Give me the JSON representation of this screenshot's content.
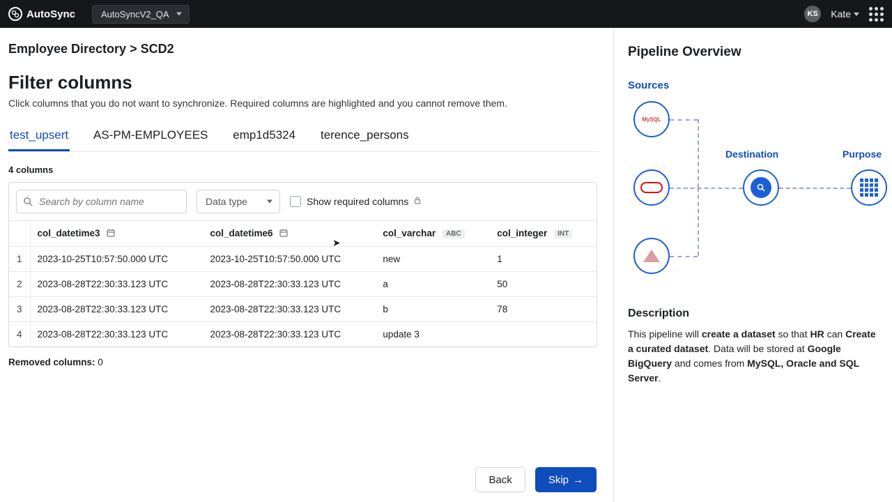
{
  "topbar": {
    "brand": "AutoSync",
    "environment": "AutoSyncV2_QA",
    "user_initials": "KS",
    "user_name": "Kate"
  },
  "breadcrumb": "Employee Directory > SCD2",
  "page": {
    "title": "Filter columns",
    "description": "Click columns that you do not want to synchronize. Required columns are highlighted and you cannot remove them."
  },
  "tabs": [
    {
      "label": "test_upsert",
      "active": true
    },
    {
      "label": "AS-PM-EMPLOYEES",
      "active": false
    },
    {
      "label": "emp1d5324",
      "active": false
    },
    {
      "label": "terence_persons",
      "active": false
    }
  ],
  "count_label": "4 columns",
  "toolbar": {
    "search_placeholder": "Search by column name",
    "datatype_label": "Data type",
    "show_required_label": "Show required columns"
  },
  "columns": [
    {
      "name": "col_datetime3",
      "type_badge": "date",
      "icon": "calendar"
    },
    {
      "name": "col_datetime6",
      "type_badge": "date",
      "icon": "calendar"
    },
    {
      "name": "col_varchar",
      "type_badge": "ABC",
      "icon": "text"
    },
    {
      "name": "col_integer",
      "type_badge": "INT",
      "icon": "text"
    }
  ],
  "rows": [
    {
      "n": "1",
      "c1": "2023-10-25T10:57:50.000 UTC",
      "c2": "2023-10-25T10:57:50.000 UTC",
      "c3": "new",
      "c4": "1"
    },
    {
      "n": "2",
      "c1": "2023-08-28T22:30:33.123 UTC",
      "c2": "2023-08-28T22:30:33.123 UTC",
      "c3": "a",
      "c4": "50"
    },
    {
      "n": "3",
      "c1": "2023-08-28T22:30:33.123 UTC",
      "c2": "2023-08-28T22:30:33.123 UTC",
      "c3": "b",
      "c4": "78"
    },
    {
      "n": "4",
      "c1": "2023-08-28T22:30:33.123 UTC",
      "c2": "2023-08-28T22:30:33.123 UTC",
      "c3": "update 3",
      "c4": ""
    }
  ],
  "removed": {
    "label": "Removed columns:",
    "count": "0"
  },
  "buttons": {
    "back": "Back",
    "skip": "Skip"
  },
  "sidebar": {
    "title": "Pipeline Overview",
    "sources_label": "Sources",
    "destination_label": "Destination",
    "purpose_label": "Purpose",
    "source_nodes": [
      "MySQL",
      "Oracle",
      "SQL Server"
    ],
    "destination_node": "Google BigQuery",
    "purpose_node": "Curated dataset",
    "description_title": "Description",
    "description_parts": {
      "p1": "This pipeline will ",
      "b1": "create a dataset",
      "p2": " so that ",
      "b2": "HR",
      "p3": " can ",
      "b3": "Create a curated dataset",
      "p4": ". Data will be stored at ",
      "b4": "Google BigQuery",
      "p5": " and comes from ",
      "b5": "MySQL, Oracle and SQL Server",
      "p6": "."
    }
  }
}
